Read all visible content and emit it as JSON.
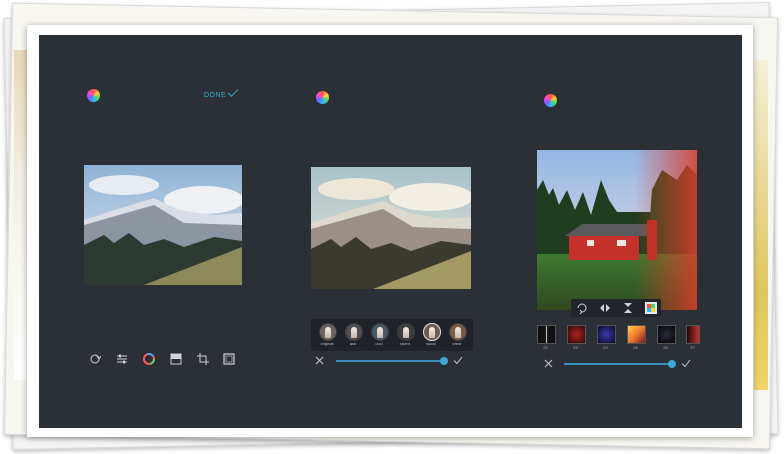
{
  "panel1": {
    "logo": "rainbow-logo-icon",
    "done_label": "DONE",
    "photo": "mountain-landscape-photo",
    "tools": [
      "rotate-icon",
      "adjust-icon",
      "color-wheel-icon",
      "contrast-icon",
      "crop-icon",
      "frame-icon"
    ]
  },
  "panel2": {
    "logo": "rainbow-logo-icon",
    "photo": "mountain-landscape-photo-filtered",
    "filters": [
      {
        "label": "original"
      },
      {
        "label": "ash"
      },
      {
        "label": "cool"
      },
      {
        "label": "raven"
      },
      {
        "label": "wood"
      },
      {
        "label": "crest"
      }
    ],
    "selected_filter": 4,
    "slider_value": 1.0
  },
  "panel3": {
    "logo": "rainbow-logo-icon",
    "photo": "red-cabin-forest-photo",
    "tool_icons": [
      "rotate-icon",
      "flip-horizontal-icon",
      "flip-vertical-icon",
      "texture-icon"
    ],
    "swatches": [
      {
        "label": "22",
        "color": "#000000"
      },
      {
        "label": "23",
        "color": "#6b1416"
      },
      {
        "label": "24",
        "color": "#1a1a57"
      },
      {
        "label": "25",
        "color": "#f07a2b"
      },
      {
        "label": "26",
        "color": "#101018"
      },
      {
        "label": "27",
        "color": "#c23232"
      }
    ],
    "slider_value": 1.0
  },
  "colors": {
    "background": "#2b2f36",
    "accent": "#2fb0d6"
  }
}
